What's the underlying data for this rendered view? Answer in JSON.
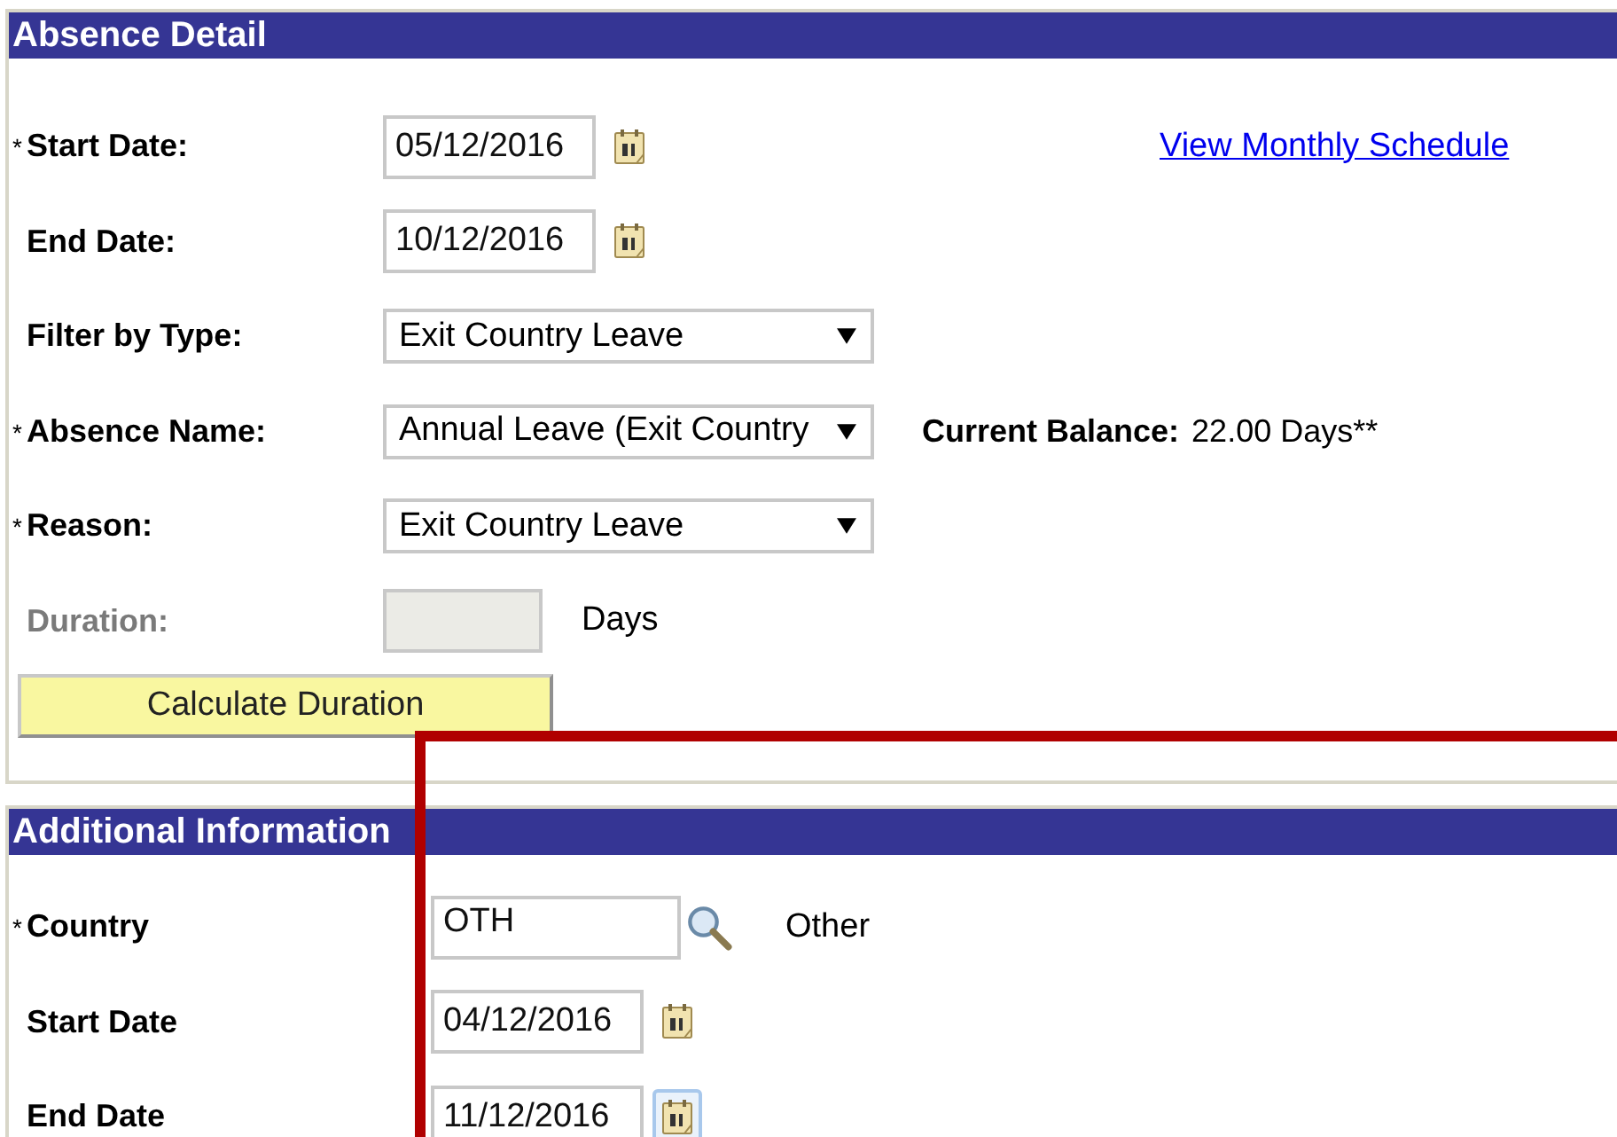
{
  "absence_detail": {
    "title": "Absence Detail",
    "link": "View Monthly Schedule",
    "fields": [
      {
        "kind": "date",
        "mark": "*",
        "label": "Start Date:",
        "value": "05/12/2016",
        "disabled": false,
        "focused": false
      },
      {
        "kind": "date",
        "label": "End Date:",
        "value": "10/12/2016",
        "disabled": false,
        "focused": false
      },
      {
        "kind": "select",
        "label": "Filter by Type:",
        "value": "Exit Country Leave",
        "disabled": false
      },
      {
        "kind": "select",
        "mark": "*",
        "label": "Absence Name:",
        "value": "Annual Leave (Exit Country",
        "disabled": false,
        "balance_label": "Current Balance:",
        "balance_value": "22.00 Days**"
      },
      {
        "kind": "select",
        "mark": "*",
        "label": "Reason:",
        "value": "Exit Country Leave",
        "disabled": false
      },
      {
        "kind": "number",
        "label": "Duration:",
        "disabled": true,
        "unit": "Days"
      }
    ],
    "button": "Calculate Duration"
  },
  "additional_information": {
    "title": "Additional Information",
    "fields": [
      {
        "kind": "lookup",
        "mark": "*",
        "label": "Country",
        "value": "OTH",
        "disabled": false,
        "description": "Other"
      },
      {
        "kind": "date",
        "label": "Start Date",
        "value": "04/12/2016",
        "disabled": false,
        "focused": false
      },
      {
        "kind": "date",
        "label": "End Date",
        "value": "11/12/2016",
        "disabled": false,
        "focused": true
      }
    ]
  }
}
